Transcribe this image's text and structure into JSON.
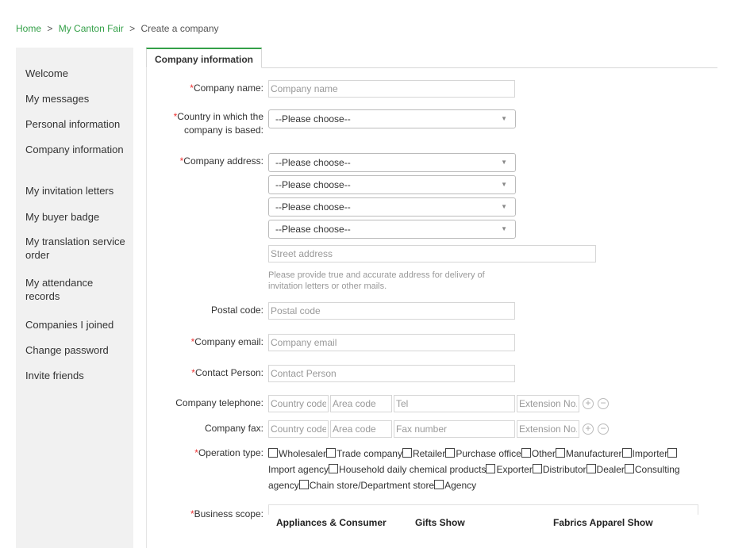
{
  "breadcrumb": {
    "home": "Home",
    "sep1": ">",
    "my_canton_fair": "My Canton Fair",
    "sep2": ">",
    "current": "Create a company"
  },
  "sidebar": {
    "items": [
      {
        "label": "Welcome"
      },
      {
        "label": "My messages"
      },
      {
        "label": "Personal information"
      },
      {
        "label": "Company information"
      },
      {
        "label": "My invitation letters"
      },
      {
        "label": "My buyer badge"
      },
      {
        "label": "My translation service order"
      },
      {
        "label": "My attendance records"
      },
      {
        "label": "Companies I joined"
      },
      {
        "label": "Change password"
      },
      {
        "label": "Invite friends"
      }
    ]
  },
  "tab": {
    "label": "Company information"
  },
  "form": {
    "required_mark": "*",
    "company_name": {
      "label": "Company name:",
      "placeholder": "Company name"
    },
    "country": {
      "label_line1": "Country in which the",
      "label_line2": "company is based:",
      "value": "--Please choose--"
    },
    "address": {
      "label": "Company address:",
      "selects": [
        "--Please choose--",
        "--Please choose--",
        "--Please choose--",
        "--Please choose--"
      ],
      "street_placeholder": "Street address",
      "hint_line1": "Please provide true and accurate address for delivery of",
      "hint_line2": "invitation letters or other mails."
    },
    "postal_code": {
      "label": "Postal code:",
      "placeholder": "Postal code"
    },
    "company_email": {
      "label": "Company email:",
      "placeholder": "Company email"
    },
    "contact_person": {
      "label": "Contact Person:",
      "placeholder": "Contact Person"
    },
    "telephone": {
      "label": "Company telephone:",
      "country_code": "Country code",
      "area_code": "Area code",
      "number": "Tel",
      "extension": "Extension No."
    },
    "fax": {
      "label": "Company fax:",
      "country_code": "Country code",
      "area_code": "Area code",
      "number": "Fax number",
      "extension": "Extension No."
    },
    "add_icon_glyph": "+",
    "remove_icon_glyph": "−",
    "dropdown_arrow_glyph": "▼",
    "operation_type": {
      "label": "Operation type:",
      "options": [
        "Wholesaler",
        "Trade company",
        "Retailer",
        "Purchase office",
        "Other",
        "Manufacturer",
        "Importer",
        "Import agency",
        "Household daily chemical products",
        "Exporter",
        "Distributor",
        "Dealer",
        "Consulting agency",
        "Chain store/Department store",
        "Agency"
      ]
    },
    "business_scope": {
      "label": "Business scope:",
      "columns": [
        "Appliances & Consumer",
        "Gifts Show",
        "Fabrics Apparel Show"
      ]
    }
  }
}
